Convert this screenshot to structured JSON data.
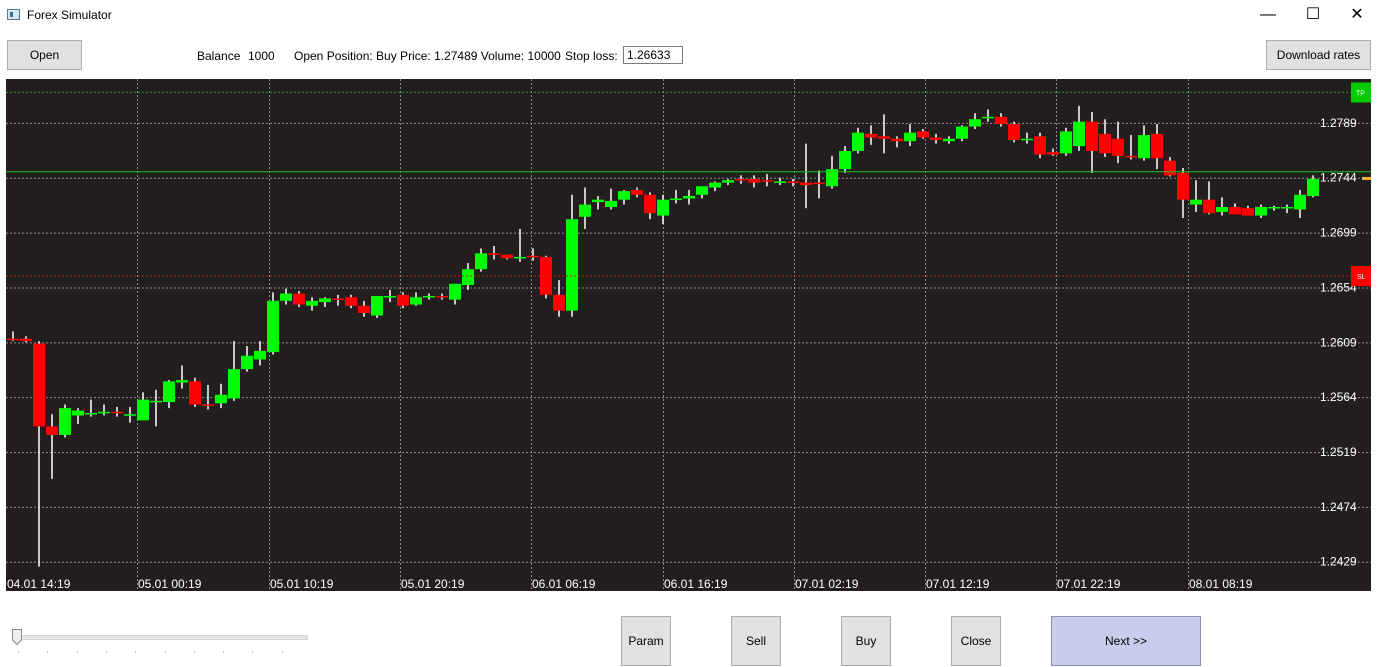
{
  "window": {
    "title": "Forex Simulator",
    "minimize": "—",
    "maximize": "☐",
    "close": "✕"
  },
  "toolbar": {
    "open_label": "Open",
    "balance_label": "Balance",
    "balance_value": "1000",
    "position_text": "Open Position: Buy Price: 1.27489 Volume: 10000",
    "stop_loss_label": "Stop loss:",
    "stop_loss_value": "1.26633",
    "download_label": "Download rates"
  },
  "buttons": {
    "param": "Param",
    "sell": "Sell",
    "buy": "Buy",
    "close": "Close",
    "next": "Next >>"
  },
  "slider": {
    "value": 0
  },
  "colors": {
    "background": "#221e1e",
    "bull": "#00ff00",
    "bear": "#ff0000",
    "grid": "#8c8c8c",
    "tp_line": "#2ca02c",
    "position_line": "#1fbf1f",
    "sl_line": "#b22222",
    "next_button": "#c7cdea"
  },
  "chart_data": {
    "type": "candlestick",
    "ylim": [
      1.2405,
      1.2825
    ],
    "y_ticks": [
      "1.2789",
      "1.2744",
      "1.2699",
      "1.2654",
      "1.2609",
      "1.2564",
      "1.2519",
      "1.2474",
      "1.2429"
    ],
    "x_ticks": [
      "04.01 14:19",
      "05.01 00:19",
      "05.01 10:19",
      "05.01 20:19",
      "06.01 06:19",
      "06.01 16:19",
      "07.01 02:19",
      "07.01 12:19",
      "07.01 22:19",
      "08.01 08:19"
    ],
    "lines": [
      {
        "name": "TP",
        "price": 1.2814,
        "label": "TP"
      },
      {
        "name": "position",
        "price": 1.27489
      },
      {
        "name": "SL",
        "price": 1.26633,
        "label": "SL"
      }
    ],
    "candles": [
      {
        "o": 1.2612,
        "h": 1.2618,
        "l": 1.261,
        "c": 1.2611
      },
      {
        "o": 1.2612,
        "h": 1.2614,
        "l": 1.2609,
        "c": 1.261
      },
      {
        "o": 1.2608,
        "h": 1.261,
        "l": 1.2425,
        "c": 1.254
      },
      {
        "o": 1.254,
        "h": 1.255,
        "l": 1.2497,
        "c": 1.2533
      },
      {
        "o": 1.2533,
        "h": 1.2558,
        "l": 1.2531,
        "c": 1.2555
      },
      {
        "o": 1.2549,
        "h": 1.2555,
        "l": 1.2542,
        "c": 1.2553
      },
      {
        "o": 1.2551,
        "h": 1.2562,
        "l": 1.2548,
        "c": 1.2551
      },
      {
        "o": 1.2552,
        "h": 1.2558,
        "l": 1.2549,
        "c": 1.2552
      },
      {
        "o": 1.2552,
        "h": 1.2556,
        "l": 1.2548,
        "c": 1.2551
      },
      {
        "o": 1.255,
        "h": 1.2556,
        "l": 1.2543,
        "c": 1.255
      },
      {
        "o": 1.2545,
        "h": 1.2568,
        "l": 1.2545,
        "c": 1.2562
      },
      {
        "o": 1.256,
        "h": 1.257,
        "l": 1.254,
        "c": 1.2561
      },
      {
        "o": 1.256,
        "h": 1.2578,
        "l": 1.2555,
        "c": 1.2577
      },
      {
        "o": 1.2576,
        "h": 1.259,
        "l": 1.2571,
        "c": 1.2578
      },
      {
        "o": 1.2577,
        "h": 1.258,
        "l": 1.2556,
        "c": 1.2558
      },
      {
        "o": 1.2558,
        "h": 1.2574,
        "l": 1.2554,
        "c": 1.2557
      },
      {
        "o": 1.2559,
        "h": 1.2575,
        "l": 1.2555,
        "c": 1.2566
      },
      {
        "o": 1.2563,
        "h": 1.261,
        "l": 1.2561,
        "c": 1.2587
      },
      {
        "o": 1.2587,
        "h": 1.2606,
        "l": 1.2585,
        "c": 1.2598
      },
      {
        "o": 1.2595,
        "h": 1.261,
        "l": 1.259,
        "c": 1.2602
      },
      {
        "o": 1.2601,
        "h": 1.265,
        "l": 1.2599,
        "c": 1.2643
      },
      {
        "o": 1.2643,
        "h": 1.2653,
        "l": 1.264,
        "c": 1.2649
      },
      {
        "o": 1.2649,
        "h": 1.2651,
        "l": 1.2638,
        "c": 1.264
      },
      {
        "o": 1.2639,
        "h": 1.2646,
        "l": 1.2635,
        "c": 1.2643
      },
      {
        "o": 1.2642,
        "h": 1.2646,
        "l": 1.2638,
        "c": 1.2645
      },
      {
        "o": 1.2645,
        "h": 1.2648,
        "l": 1.2639,
        "c": 1.2644
      },
      {
        "o": 1.2646,
        "h": 1.2648,
        "l": 1.2637,
        "c": 1.2639
      },
      {
        "o": 1.2639,
        "h": 1.2643,
        "l": 1.263,
        "c": 1.2633
      },
      {
        "o": 1.2631,
        "h": 1.2647,
        "l": 1.2629,
        "c": 1.2647
      },
      {
        "o": 1.2647,
        "h": 1.2652,
        "l": 1.2642,
        "c": 1.2647
      },
      {
        "o": 1.2648,
        "h": 1.265,
        "l": 1.2637,
        "c": 1.2639
      },
      {
        "o": 1.264,
        "h": 1.265,
        "l": 1.2639,
        "c": 1.2646
      },
      {
        "o": 1.2646,
        "h": 1.2649,
        "l": 1.2644,
        "c": 1.2647
      },
      {
        "o": 1.2647,
        "h": 1.2649,
        "l": 1.2644,
        "c": 1.2646
      },
      {
        "o": 1.2644,
        "h": 1.2657,
        "l": 1.264,
        "c": 1.2657
      },
      {
        "o": 1.2656,
        "h": 1.2674,
        "l": 1.2652,
        "c": 1.2669
      },
      {
        "o": 1.2669,
        "h": 1.2686,
        "l": 1.2667,
        "c": 1.2682
      },
      {
        "o": 1.2682,
        "h": 1.2688,
        "l": 1.2677,
        "c": 1.2681
      },
      {
        "o": 1.2681,
        "h": 1.2681,
        "l": 1.2677,
        "c": 1.2678
      },
      {
        "o": 1.2678,
        "h": 1.2702,
        "l": 1.2675,
        "c": 1.2679
      },
      {
        "o": 1.268,
        "h": 1.2686,
        "l": 1.2676,
        "c": 1.2679
      },
      {
        "o": 1.2679,
        "h": 1.268,
        "l": 1.2645,
        "c": 1.2648
      },
      {
        "o": 1.2648,
        "h": 1.266,
        "l": 1.263,
        "c": 1.2635
      },
      {
        "o": 1.2635,
        "h": 1.273,
        "l": 1.263,
        "c": 1.271
      },
      {
        "o": 1.2712,
        "h": 1.2736,
        "l": 1.2702,
        "c": 1.2722
      },
      {
        "o": 1.2724,
        "h": 1.2729,
        "l": 1.2718,
        "c": 1.2726
      },
      {
        "o": 1.272,
        "h": 1.2735,
        "l": 1.2718,
        "c": 1.2725
      },
      {
        "o": 1.2726,
        "h": 1.2734,
        "l": 1.2722,
        "c": 1.2733
      },
      {
        "o": 1.2734,
        "h": 1.2736,
        "l": 1.2728,
        "c": 1.273
      },
      {
        "o": 1.273,
        "h": 1.2732,
        "l": 1.271,
        "c": 1.2715
      },
      {
        "o": 1.2713,
        "h": 1.273,
        "l": 1.2706,
        "c": 1.2726
      },
      {
        "o": 1.2726,
        "h": 1.2734,
        "l": 1.2723,
        "c": 1.2727
      },
      {
        "o": 1.2727,
        "h": 1.2734,
        "l": 1.2722,
        "c": 1.2729
      },
      {
        "o": 1.273,
        "h": 1.2736,
        "l": 1.2727,
        "c": 1.2737
      },
      {
        "o": 1.2736,
        "h": 1.2741,
        "l": 1.2733,
        "c": 1.274
      },
      {
        "o": 1.274,
        "h": 1.2743,
        "l": 1.2738,
        "c": 1.2742
      },
      {
        "o": 1.2743,
        "h": 1.2746,
        "l": 1.2739,
        "c": 1.2742
      },
      {
        "o": 1.2743,
        "h": 1.2746,
        "l": 1.2736,
        "c": 1.274
      },
      {
        "o": 1.2742,
        "h": 1.2747,
        "l": 1.2737,
        "c": 1.2741
      },
      {
        "o": 1.2741,
        "h": 1.2744,
        "l": 1.2738,
        "c": 1.2741
      },
      {
        "o": 1.2741,
        "h": 1.2743,
        "l": 1.2737,
        "c": 1.274
      },
      {
        "o": 1.274,
        "h": 1.2772,
        "l": 1.2719,
        "c": 1.2738
      },
      {
        "o": 1.274,
        "h": 1.275,
        "l": 1.2727,
        "c": 1.2739
      },
      {
        "o": 1.2737,
        "h": 1.2762,
        "l": 1.2735,
        "c": 1.2751
      },
      {
        "o": 1.2751,
        "h": 1.277,
        "l": 1.2748,
        "c": 1.2766
      },
      {
        "o": 1.2766,
        "h": 1.2785,
        "l": 1.2764,
        "c": 1.2781
      },
      {
        "o": 1.278,
        "h": 1.2787,
        "l": 1.2771,
        "c": 1.2777
      },
      {
        "o": 1.2778,
        "h": 1.2796,
        "l": 1.2764,
        "c": 1.2776
      },
      {
        "o": 1.2776,
        "h": 1.2778,
        "l": 1.2769,
        "c": 1.2774
      },
      {
        "o": 1.2774,
        "h": 1.2788,
        "l": 1.277,
        "c": 1.2781
      },
      {
        "o": 1.2782,
        "h": 1.2784,
        "l": 1.2776,
        "c": 1.2777
      },
      {
        "o": 1.2777,
        "h": 1.278,
        "l": 1.2772,
        "c": 1.2775
      },
      {
        "o": 1.2774,
        "h": 1.2778,
        "l": 1.2772,
        "c": 1.2776
      },
      {
        "o": 1.2776,
        "h": 1.2787,
        "l": 1.2774,
        "c": 1.2786
      },
      {
        "o": 1.2786,
        "h": 1.2797,
        "l": 1.2784,
        "c": 1.2792
      },
      {
        "o": 1.2793,
        "h": 1.28,
        "l": 1.279,
        "c": 1.2794
      },
      {
        "o": 1.2794,
        "h": 1.2797,
        "l": 1.2786,
        "c": 1.2788
      },
      {
        "o": 1.2788,
        "h": 1.279,
        "l": 1.2773,
        "c": 1.2775
      },
      {
        "o": 1.2775,
        "h": 1.2781,
        "l": 1.2772,
        "c": 1.2776
      },
      {
        "o": 1.2778,
        "h": 1.2781,
        "l": 1.276,
        "c": 1.2763
      },
      {
        "o": 1.2765,
        "h": 1.2768,
        "l": 1.2762,
        "c": 1.2763
      },
      {
        "o": 1.2764,
        "h": 1.2785,
        "l": 1.2762,
        "c": 1.2782
      },
      {
        "o": 1.277,
        "h": 1.2803,
        "l": 1.2766,
        "c": 1.279
      },
      {
        "o": 1.279,
        "h": 1.2798,
        "l": 1.2748,
        "c": 1.2766
      },
      {
        "o": 1.278,
        "h": 1.2792,
        "l": 1.2761,
        "c": 1.2764
      },
      {
        "o": 1.2776,
        "h": 1.279,
        "l": 1.2756,
        "c": 1.2762
      },
      {
        "o": 1.2762,
        "h": 1.2779,
        "l": 1.2759,
        "c": 1.2761
      },
      {
        "o": 1.276,
        "h": 1.2787,
        "l": 1.2758,
        "c": 1.2779
      },
      {
        "o": 1.278,
        "h": 1.2788,
        "l": 1.2751,
        "c": 1.276
      },
      {
        "o": 1.2758,
        "h": 1.2761,
        "l": 1.2745,
        "c": 1.2746
      },
      {
        "o": 1.2748,
        "h": 1.2752,
        "l": 1.2711,
        "c": 1.2726
      },
      {
        "o": 1.2722,
        "h": 1.2742,
        "l": 1.2716,
        "c": 1.2726
      },
      {
        "o": 1.2726,
        "h": 1.2741,
        "l": 1.2714,
        "c": 1.2715
      },
      {
        "o": 1.2716,
        "h": 1.2728,
        "l": 1.2713,
        "c": 1.272
      },
      {
        "o": 1.272,
        "h": 1.2723,
        "l": 1.2715,
        "c": 1.2714
      },
      {
        "o": 1.2719,
        "h": 1.2721,
        "l": 1.2713,
        "c": 1.2713
      },
      {
        "o": 1.2713,
        "h": 1.2722,
        "l": 1.2711,
        "c": 1.272
      },
      {
        "o": 1.2719,
        "h": 1.2721,
        "l": 1.2717,
        "c": 1.272
      },
      {
        "o": 1.2719,
        "h": 1.2722,
        "l": 1.2715,
        "c": 1.272
      },
      {
        "o": 1.2718,
        "h": 1.2734,
        "l": 1.2711,
        "c": 1.273
      },
      {
        "o": 1.2729,
        "h": 1.2746,
        "l": 1.2728,
        "c": 1.2743
      }
    ]
  }
}
